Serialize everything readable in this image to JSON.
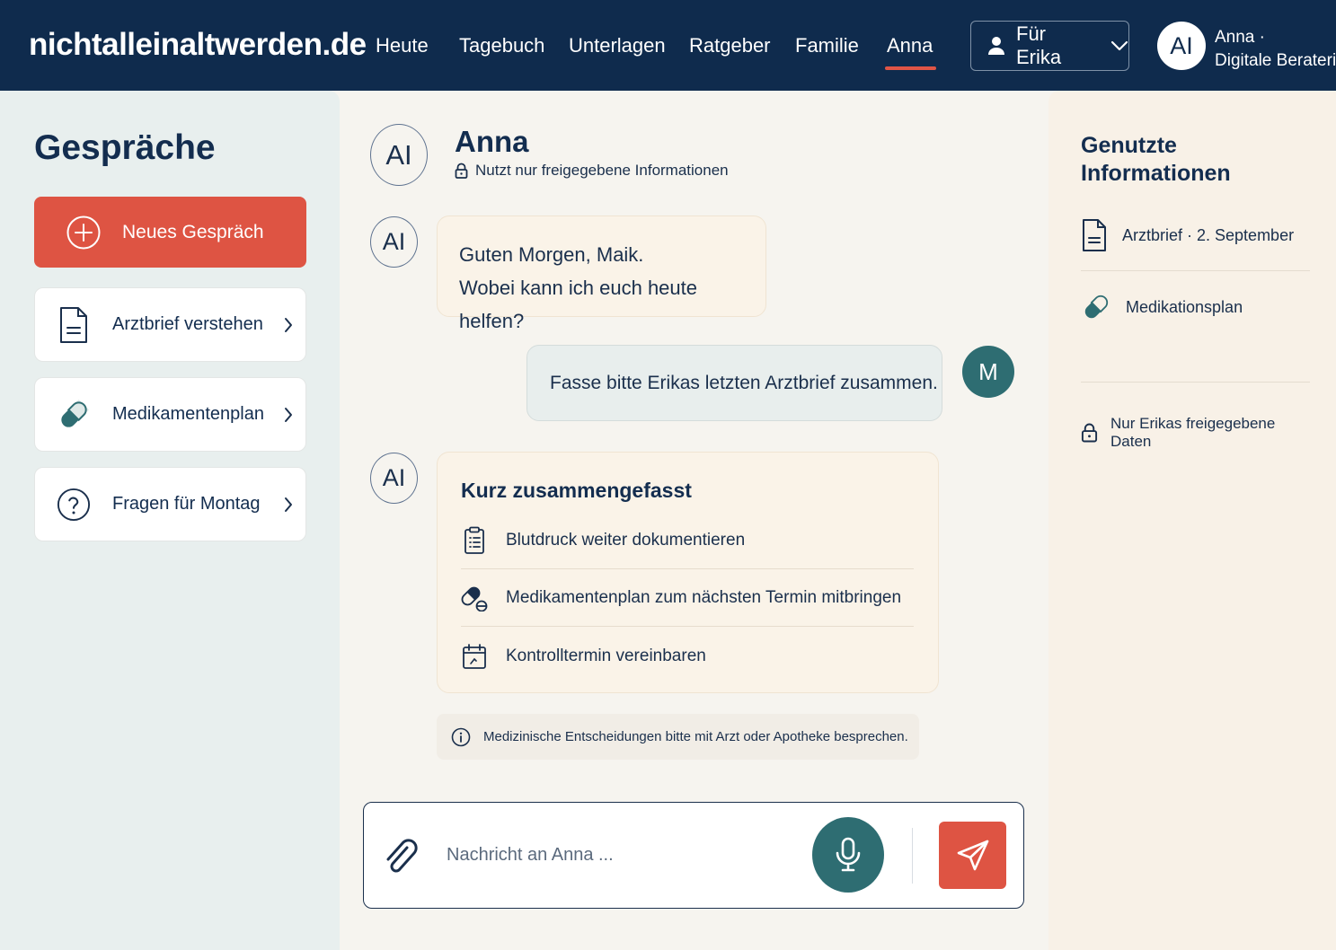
{
  "header": {
    "brand": "nichtalleinaltwerden.de",
    "nav": [
      {
        "label": "Heute"
      },
      {
        "label": "Tagebuch"
      },
      {
        "label": "Unterlagen"
      },
      {
        "label": "Ratgeber"
      },
      {
        "label": "Familie"
      },
      {
        "label": "Anna",
        "active": true
      }
    ],
    "for_label": "Für Erika",
    "avatar_initials": "AI",
    "user_name": "Anna ·",
    "user_role": "Digitale Beraterin"
  },
  "sidebar": {
    "title": "Gespräche",
    "new_button": "Neues Gespräch",
    "items": [
      {
        "label": "Arztbrief verstehen",
        "icon": "document-icon"
      },
      {
        "label": "Medikamentenplan",
        "icon": "pill-icon"
      },
      {
        "label": "Fragen für Montag",
        "icon": "question-icon"
      }
    ]
  },
  "chat": {
    "assistant_name": "Anna",
    "assistant_initials": "AI",
    "privacy_note": "Nutzt nur freigegebene Informationen",
    "greeting_line1": "Guten Morgen, Maik.",
    "greeting_line2": "Wobei kann ich euch heute helfen?",
    "user_message": "Fasse bitte Erikas letzten Arztbrief zusammen.",
    "user_initial": "M",
    "summary": {
      "title": "Kurz zusammengefasst",
      "items": [
        {
          "text": "Blutdruck weiter dokumentieren",
          "icon": "clipboard-icon"
        },
        {
          "text": "Medikamentenplan zum nächsten Termin mitbringen",
          "icon": "pills-icon"
        },
        {
          "text": "Kontrolltermin vereinbaren",
          "icon": "calendar-icon"
        }
      ]
    },
    "disclaimer": "Medizinische Entscheidungen bitte mit Arzt oder Apotheke besprechen.",
    "input_placeholder": "Nachricht an Anna ...",
    "input_value": ""
  },
  "info_panel": {
    "title": "Genutzte Informationen",
    "sources": [
      {
        "label": "Arztbrief · 2. September",
        "icon": "document-icon"
      },
      {
        "label": "Medikationsplan",
        "icon": "pill-icon"
      }
    ],
    "footer_note": "Nur Erikas freigegebene Daten"
  },
  "colors": {
    "header_bg": "#0f2b4d",
    "accent_red": "#de5443",
    "teal": "#2e6d72",
    "sidebar_bg": "#e8efee",
    "panel_bg": "#f8f1e7",
    "bubble_ai": "#faf3e8",
    "bubble_user": "#e8eeed"
  }
}
